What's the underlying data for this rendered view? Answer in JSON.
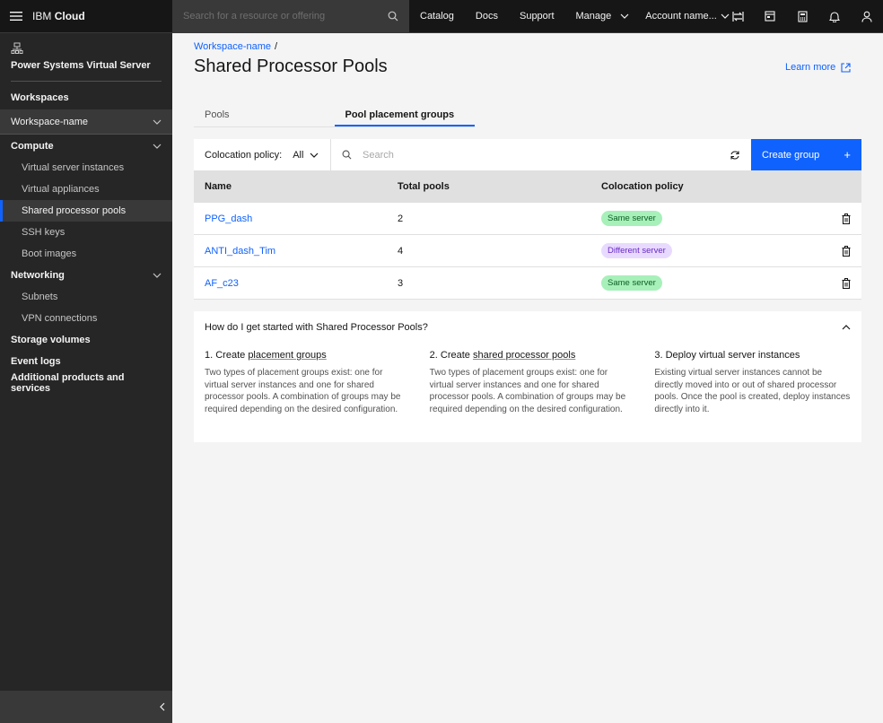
{
  "header": {
    "brand_prefix": "IBM",
    "brand_name": "Cloud",
    "search_placeholder": "Search for a resource or offering",
    "nav": [
      "Catalog",
      "Docs",
      "Support",
      "Manage"
    ],
    "account": "Account name..."
  },
  "sidebar": {
    "title": "Power Systems Virtual Server",
    "workspaces": "Workspaces",
    "workspace_name": "Workspace-name",
    "compute": "Compute",
    "compute_items": [
      "Virtual server instances",
      "Virtual appliances",
      "Shared processor pools",
      "SSH keys",
      "Boot images"
    ],
    "networking": "Networking",
    "networking_items": [
      "Subnets",
      "VPN connections"
    ],
    "storage": "Storage volumes",
    "events": "Event logs",
    "additional": "Additional products and services"
  },
  "breadcrumb": {
    "workspace": "Workspace-name",
    "sep": "/"
  },
  "page": {
    "title": "Shared Processor Pools",
    "learn_more": "Learn more"
  },
  "tabs": [
    "Pools",
    "Pool placement groups"
  ],
  "toolbar": {
    "coloc_label": "Colocation policy:",
    "coloc_value": "All",
    "search_placeholder": "Search",
    "create_label": "Create group",
    "create_plus": "+"
  },
  "table": {
    "headers": [
      "Name",
      "Total pools",
      "Colocation policy"
    ],
    "rows": [
      {
        "name": "PPG_dash",
        "pools": "2",
        "policy": "Same server"
      },
      {
        "name": "ANTI_dash_Tim",
        "pools": "4",
        "policy": "Different server"
      },
      {
        "name": "AF_c23",
        "pools": "3",
        "policy": "Same server"
      }
    ]
  },
  "help": {
    "question": "How do I get started with Shared Processor Pools?",
    "steps": [
      {
        "prefix": "1. Create ",
        "link": "placement groups",
        "text": "Two types of placement groups exist: one for virtual server instances and one for shared processor pools. A combination of groups may be required depending on the desired configuration."
      },
      {
        "prefix": "2. Create ",
        "link": "shared processor pools",
        "text": "Two types of placement groups exist: one for virtual server instances and one for shared processor pools. A combination of groups may be required depending on the desired configuration."
      },
      {
        "prefix": "3. Deploy virtual server instances",
        "link": "",
        "text": "Existing virtual server instances cannot be directly moved into or out of shared processor pools. Once the pool is created, deploy instances directly into it."
      }
    ]
  },
  "colors": {
    "accent": "#0f62fe",
    "shell": "#161616",
    "sidebar": "#262626"
  }
}
